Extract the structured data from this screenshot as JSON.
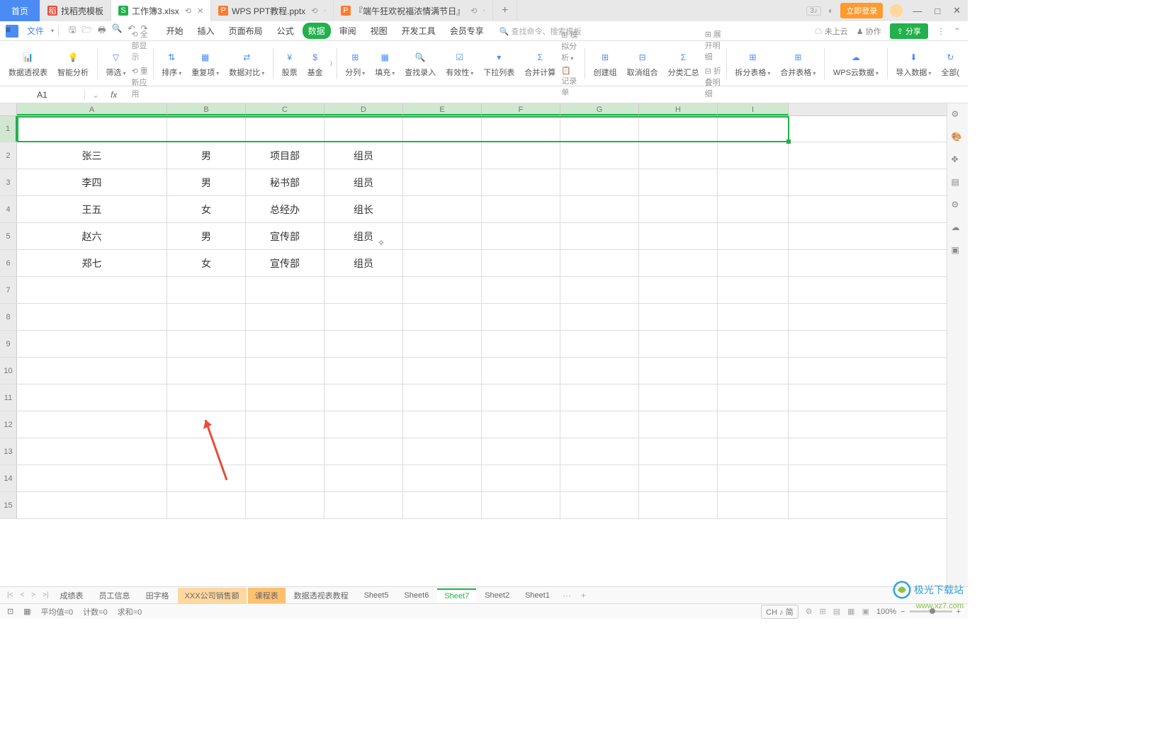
{
  "titlebar": {
    "tabs": [
      {
        "label": "首页",
        "type": "home"
      },
      {
        "icon": "稻",
        "iconColor": "#e74c3c",
        "label": "找稻壳模板"
      },
      {
        "icon": "S",
        "iconColor": "#22b14c",
        "label": "工作簿3.xlsx",
        "active": true,
        "pinned": true
      },
      {
        "icon": "P",
        "iconColor": "#ff7b2e",
        "label": "WPS PPT教程.pptx"
      },
      {
        "icon": "P",
        "iconColor": "#ff7b2e",
        "label": "『端午狂欢祝福浓情满节日』"
      }
    ],
    "badge": "3",
    "login": "立即登录"
  },
  "menu": {
    "file": "文件",
    "items": [
      "开始",
      "插入",
      "页面布局",
      "公式",
      "数据",
      "审阅",
      "视图",
      "开发工具",
      "会员专享"
    ],
    "active_index": 4,
    "search_placeholder": "查找命令、搜索模板",
    "cloud": "未上云",
    "collab": "协作",
    "share": "分享"
  },
  "ribbon": {
    "pivot": "数据透视表",
    "smart": "智能分析",
    "filter": "筛选",
    "show_all": "全部显示",
    "reapply": "重新应用",
    "sort": "排序",
    "dup": "重复项",
    "compare": "数据对比",
    "stock": "股票",
    "fund": "基金",
    "split": "分列",
    "fill": "填充",
    "find": "查找录入",
    "valid": "有效性",
    "dropdown": "下拉列表",
    "merge": "合并计算",
    "sim": "模拟分析",
    "record": "记录单",
    "group": "创建组",
    "ungroup": "取消组合",
    "subtotal": "分类汇总",
    "expand": "展开明细",
    "collapse": "折叠明细",
    "splitTable": "拆分表格",
    "mergeTable": "合并表格",
    "wpsCloud": "WPS云数据",
    "import": "导入数据",
    "all": "全部("
  },
  "fbar": {
    "name": "A1",
    "fx": "fx",
    "value": ""
  },
  "cols": [
    "A",
    "B",
    "C",
    "D",
    "E",
    "F",
    "G",
    "H",
    "I"
  ],
  "grid": [
    {
      "A": "",
      "B": "",
      "C": "",
      "D": ""
    },
    {
      "A": "张三",
      "B": "男",
      "C": "项目部",
      "D": "组员"
    },
    {
      "A": "李四",
      "B": "男",
      "C": "秘书部",
      "D": "组员"
    },
    {
      "A": "王五",
      "B": "女",
      "C": "总经办",
      "D": "组长"
    },
    {
      "A": "赵六",
      "B": "男",
      "C": "宣传部",
      "D": "组员"
    },
    {
      "A": "郑七",
      "B": "女",
      "C": "宣传部",
      "D": "组员"
    },
    {
      "A": "",
      "B": "",
      "C": "",
      "D": ""
    },
    {
      "A": "",
      "B": "",
      "C": "",
      "D": ""
    },
    {
      "A": "",
      "B": "",
      "C": "",
      "D": ""
    },
    {
      "A": "",
      "B": "",
      "C": "",
      "D": ""
    },
    {
      "A": "",
      "B": "",
      "C": "",
      "D": ""
    },
    {
      "A": "",
      "B": "",
      "C": "",
      "D": ""
    },
    {
      "A": "",
      "B": "",
      "C": "",
      "D": ""
    },
    {
      "A": "",
      "B": "",
      "C": "",
      "D": ""
    },
    {
      "A": "",
      "B": "",
      "C": "",
      "D": ""
    }
  ],
  "sheets": [
    "成绩表",
    "员工信息",
    "田字格",
    "XXX公司销售额",
    "课程表",
    "数据透视表教程",
    "Sheet5",
    "Sheet6",
    "Sheet7",
    "Sheet2",
    "Sheet1"
  ],
  "sheets_active": 8,
  "status": {
    "left1": "平均值=0",
    "left2": "计数=0",
    "left3": "求和=0",
    "ime": "CH ♪ 简",
    "zoom": "100%"
  },
  "watermark": {
    "text": "极光下载站",
    "url": "www.xz7.com"
  }
}
